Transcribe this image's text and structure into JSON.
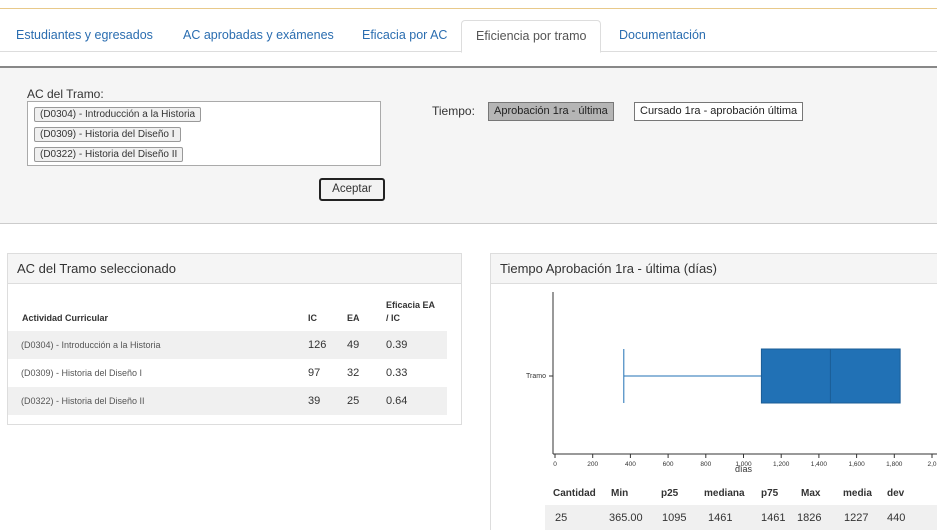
{
  "tabs": [
    {
      "label": "Estudiantes y egresados",
      "active": false
    },
    {
      "label": "AC aprobadas y exámenes",
      "active": false
    },
    {
      "label": "Eficacia por AC",
      "active": false
    },
    {
      "label": "Eficiencia por tramo",
      "active": true
    },
    {
      "label": "Documentación",
      "active": false
    }
  ],
  "filter": {
    "ac_label": "AC del Tramo:",
    "ac_items": [
      "(D0304) - Introducción a la Historia",
      "(D0309) - Historia del Diseño I",
      "(D0322) - Historia del Diseño II"
    ],
    "tiempo_label": "Tiempo:",
    "tiempo_options": [
      {
        "label": "Aprobación 1ra - última",
        "selected": true
      },
      {
        "label": "Cursado 1ra - aprobación última",
        "selected": false
      }
    ],
    "accept_label": "Aceptar"
  },
  "table_panel": {
    "title": "AC del Tramo seleccionado",
    "columns": [
      "Actividad Curricular",
      "IC",
      "EA",
      "Eficacia EA",
      "/ IC"
    ],
    "rows": [
      {
        "ac": "(D0304) - Introducción a la Historia",
        "ic": "126",
        "ea": "49",
        "eff": "0.39"
      },
      {
        "ac": "(D0309) - Historia del Diseño I",
        "ic": "97",
        "ea": "32",
        "eff": "0.33"
      },
      {
        "ac": "(D0322) - Historia del Diseño II",
        "ic": "39",
        "ea": "25",
        "eff": "0.64"
      }
    ]
  },
  "chart_panel": {
    "title": "Tiempo Aprobación 1ra - última (días)"
  },
  "chart_data": {
    "type": "boxplot",
    "category": "Tramo",
    "xlabel": "días",
    "xlim": [
      0,
      2000
    ],
    "x_ticks": [
      "0",
      "200",
      "400",
      "600",
      "800",
      "1,000",
      "1,200",
      "1,400",
      "1,600",
      "1,800",
      "2,0"
    ],
    "box": {
      "min": 365,
      "q1": 1095,
      "median": 1461,
      "q3": 1461,
      "max": 1826
    },
    "color": "#2171b5"
  },
  "stats": {
    "headers": [
      "Cantidad",
      "Min",
      "p25",
      "mediana",
      "p75",
      "Max",
      "media",
      "dev"
    ],
    "values": [
      "25",
      "365.00",
      "1095",
      "1461",
      "1461",
      "1826",
      "1227",
      "440"
    ]
  }
}
